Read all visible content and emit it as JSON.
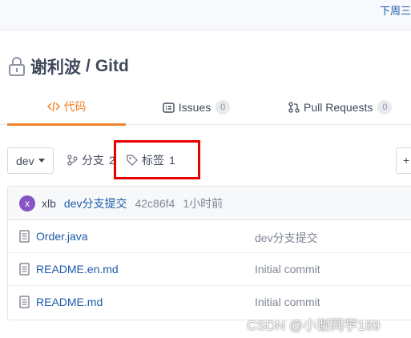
{
  "topbar": {
    "link": "下周三"
  },
  "repo": {
    "owner": "谢利波",
    "separator": "/",
    "name": "Gitd",
    "icon": "lock-icon"
  },
  "tabs": [
    {
      "label": "代码",
      "icon": "code-icon",
      "active": true
    },
    {
      "label": "Issues",
      "icon": "issues-icon",
      "count": "0"
    },
    {
      "label": "Pull Requests",
      "icon": "pull-request-icon",
      "count": "0"
    }
  ],
  "toolbar": {
    "branch": "dev",
    "branches_label": "分支",
    "branches_count": "2",
    "tags_label": "标签",
    "tags_count": "1",
    "plus_label": "+"
  },
  "commit": {
    "avatar_letter": "x",
    "author": "xlb",
    "message": "dev分支提交",
    "sha": "42c86f4",
    "time": "1小时前"
  },
  "files": [
    {
      "name": "Order.java",
      "commit": "dev分支提交"
    },
    {
      "name": "README.en.md",
      "commit": "Initial commit"
    },
    {
      "name": "README.md",
      "commit": "Initial commit"
    }
  ],
  "watermark": "CSDN @小谢同学189",
  "colors": {
    "accent": "#f0812a",
    "link": "#1e5ba8",
    "highlight": "#e60000",
    "avatar": "#8654c4"
  }
}
